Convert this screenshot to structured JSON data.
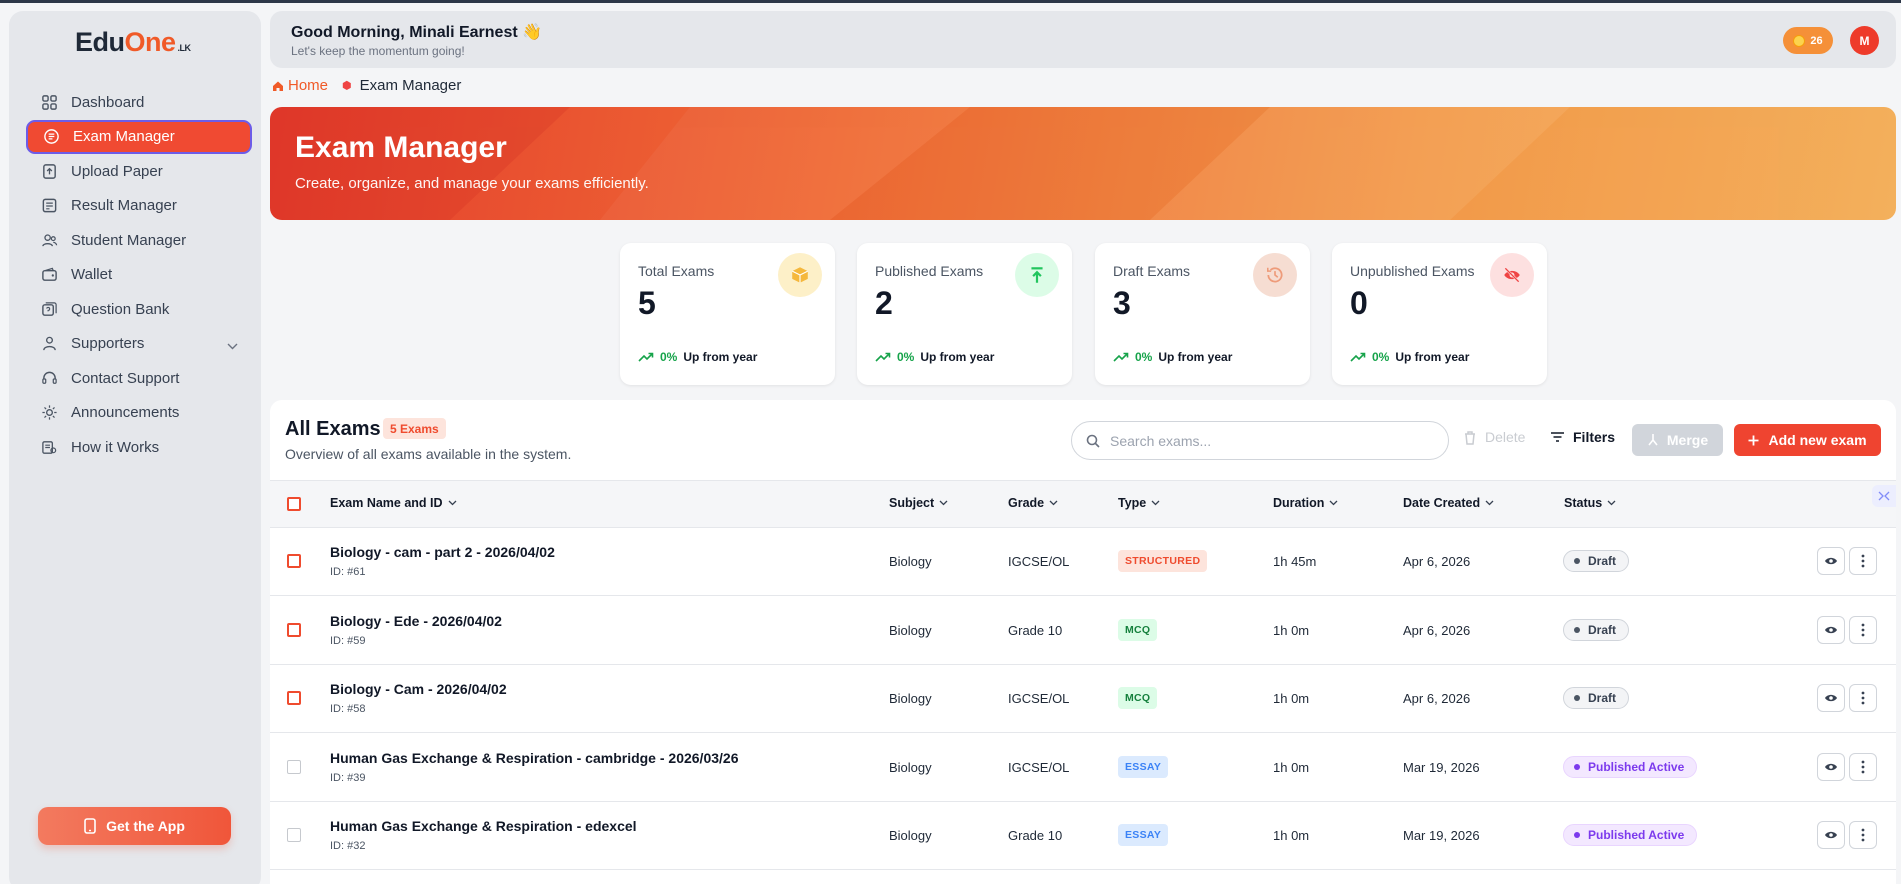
{
  "brand": {
    "edu": "Edu",
    "one": "One",
    "lk": ".LK"
  },
  "sidebar": {
    "items": [
      {
        "label": "Dashboard",
        "icon": "grid-icon"
      },
      {
        "label": "Exam Manager",
        "icon": "exam-icon",
        "active": true
      },
      {
        "label": "Upload Paper",
        "icon": "upload-icon"
      },
      {
        "label": "Result Manager",
        "icon": "result-icon"
      },
      {
        "label": "Student Manager",
        "icon": "students-icon"
      },
      {
        "label": "Wallet",
        "icon": "wallet-icon"
      },
      {
        "label": "Question Bank",
        "icon": "question-bank-icon"
      },
      {
        "label": "Supporters",
        "icon": "supporters-icon",
        "expandable": true
      },
      {
        "label": "Contact Support",
        "icon": "support-icon"
      },
      {
        "label": "Announcements",
        "icon": "announcement-icon"
      },
      {
        "label": "How it Works",
        "icon": "how-it-works-icon"
      }
    ],
    "get_app_label": "Get the App"
  },
  "header": {
    "greeting": "Good Morning, Minali Earnest 👋",
    "subtitle": "Let's keep the momentum going!",
    "coins": "26",
    "avatar_initial": "M"
  },
  "breadcrumb": {
    "home": "Home",
    "current": "Exam Manager"
  },
  "banner": {
    "title": "Exam Manager",
    "subtitle": "Create, organize, and manage your exams efficiently."
  },
  "stats": [
    {
      "label": "Total Exams",
      "value": "5",
      "trend_pct": "0%",
      "trend_text": "Up from year",
      "icon": "box-icon",
      "icon_bg": "#fdf0c8",
      "icon_color": "#f5b83d"
    },
    {
      "label": "Published Exams",
      "value": "2",
      "trend_pct": "0%",
      "trend_text": "Up from year",
      "icon": "publish-icon",
      "icon_bg": "#dcfce7",
      "icon_color": "#22c55e"
    },
    {
      "label": "Draft Exams",
      "value": "3",
      "trend_pct": "0%",
      "trend_text": "Up from year",
      "icon": "history-icon",
      "icon_bg": "#f6ddd2",
      "icon_color": "#ee9b7a"
    },
    {
      "label": "Unpublished Exams",
      "value": "0",
      "trend_pct": "0%",
      "trend_text": "Up from year",
      "icon": "eye-off-icon",
      "icon_bg": "#fde0e0",
      "icon_color": "#ef4444"
    }
  ],
  "exams": {
    "title": "All Exams",
    "count_badge": "5 Exams",
    "subtitle": "Overview of all exams available in the system.",
    "search_placeholder": "Search exams...",
    "delete_label": "Delete",
    "filters_label": "Filters",
    "merge_label": "Merge",
    "add_label": "Add new exam",
    "columns": [
      "Exam Name and ID",
      "Subject",
      "Grade",
      "Type",
      "Duration",
      "Date Created",
      "Status"
    ],
    "rows": [
      {
        "name": "Biology - cam - part 2 - 2026/04/02",
        "id": "ID: #61",
        "subject": "Biology",
        "grade": "IGCSE/OL",
        "type": "STRUCTURED",
        "duration": "1h 45m",
        "date": "Apr 6, 2026",
        "status": "Draft"
      },
      {
        "name": "Biology - Ede - 2026/04/02",
        "id": "ID: #59",
        "subject": "Biology",
        "grade": "Grade 10",
        "type": "MCQ",
        "duration": "1h 0m",
        "date": "Apr 6, 2026",
        "status": "Draft"
      },
      {
        "name": "Biology - Cam - 2026/04/02",
        "id": "ID: #58",
        "subject": "Biology",
        "grade": "IGCSE/OL",
        "type": "MCQ",
        "duration": "1h 0m",
        "date": "Apr 6, 2026",
        "status": "Draft"
      },
      {
        "name": "Human Gas Exchange & Respiration - cambridge - 2026/03/26",
        "id": "ID: #39",
        "subject": "Biology",
        "grade": "IGCSE/OL",
        "type": "ESSAY",
        "duration": "1h 0m",
        "date": "Mar 19, 2026",
        "status": "Published Active"
      },
      {
        "name": "Human Gas Exchange & Respiration - edexcel",
        "id": "ID: #32",
        "subject": "Biology",
        "grade": "Grade 10",
        "type": "ESSAY",
        "duration": "1h 0m",
        "date": "Mar 19, 2026",
        "status": "Published Active"
      }
    ]
  },
  "colors": {
    "accent": "#f04a32",
    "brand_orange": "#f05a28"
  }
}
